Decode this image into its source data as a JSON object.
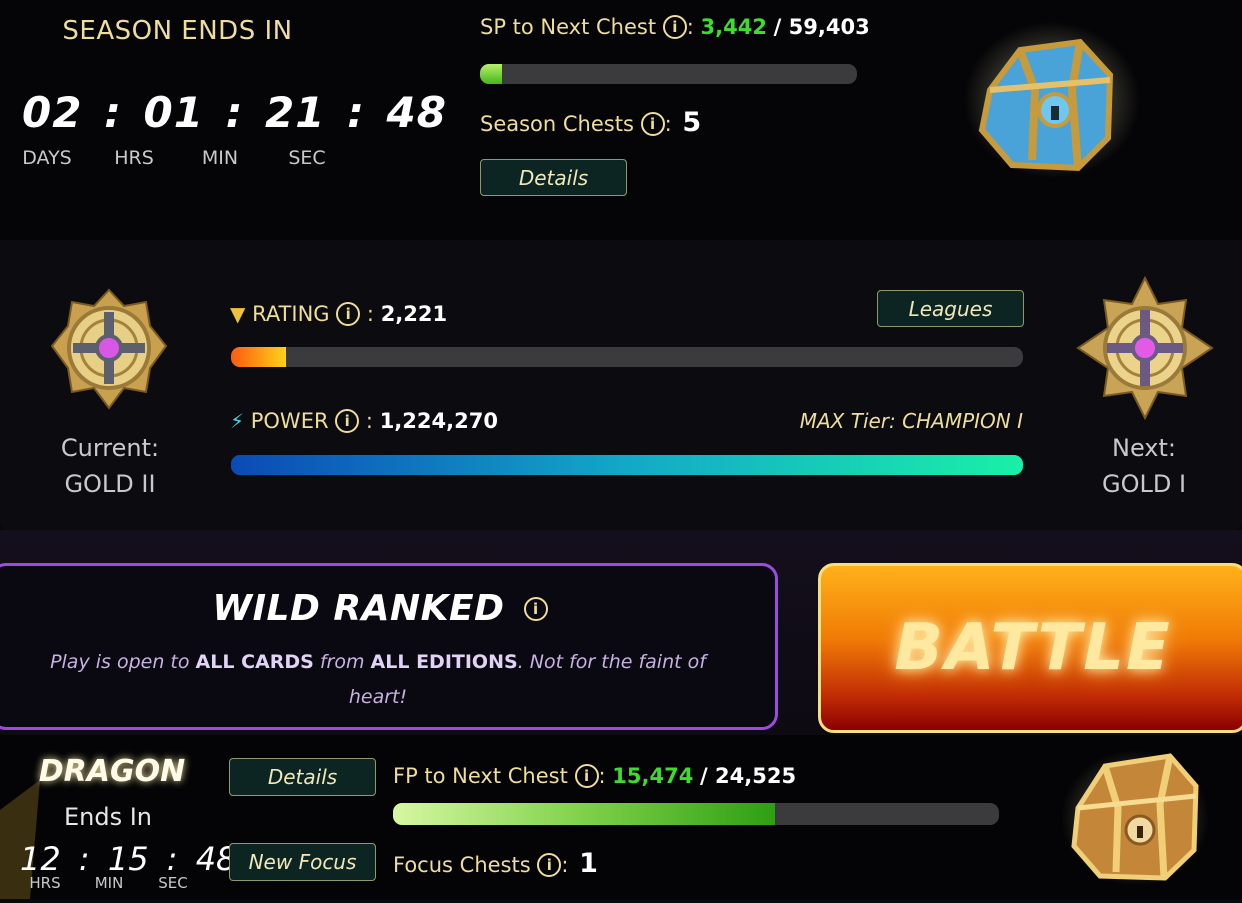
{
  "season": {
    "title": "SEASON ENDS IN",
    "countdown": {
      "days": "02",
      "hours": "01",
      "minutes": "21",
      "seconds": "48"
    },
    "units": {
      "days": "DAYS",
      "hours": "HRS",
      "minutes": "MIN",
      "seconds": "SEC"
    },
    "sp_label": "SP to Next Chest",
    "sp_current": "3,442",
    "sp_total": "59,403",
    "sp_progress_fraction": 0.058,
    "chests_label": "Season Chests",
    "chests_value": "5",
    "details_button": "Details"
  },
  "league": {
    "rating_label": "RATING",
    "rating_value": "2,221",
    "rating_progress_fraction": 0.07,
    "leagues_button": "Leagues",
    "power_label": "POWER",
    "power_value": "1,224,270",
    "power_progress_fraction": 1.0,
    "max_tier": "MAX Tier: CHAMPION I",
    "current_label": "Current:",
    "current_league": "GOLD II",
    "next_label": "Next:",
    "next_league": "GOLD I"
  },
  "mode": {
    "title": "WILD RANKED",
    "desc_prefix": "Play is open to",
    "desc_cards": "ALL CARDS",
    "desc_from": "from",
    "desc_editions": "ALL EDITIONS",
    "desc_suffix": ". Not for the faint of heart!",
    "battle_button": "BATTLE"
  },
  "focus": {
    "element": "DRAGON",
    "ends_in_label": "Ends In",
    "countdown": {
      "hours": "12",
      "minutes": "15",
      "seconds": "48"
    },
    "units": {
      "hours": "HRS",
      "minutes": "MIN",
      "seconds": "SEC"
    },
    "details_button": "Details",
    "new_focus_button": "New Focus",
    "fp_label": "FP to Next Chest",
    "fp_current": "15,474",
    "fp_total": "24,525",
    "fp_progress_fraction": 0.631,
    "chests_label": "Focus Chests",
    "chests_value": "1"
  },
  "colors": {
    "accent_gold": "#efdd9c",
    "progress_green": "#3ddc2f",
    "battle_orange": "#f07a06",
    "mode_border": "#9b4be0"
  }
}
